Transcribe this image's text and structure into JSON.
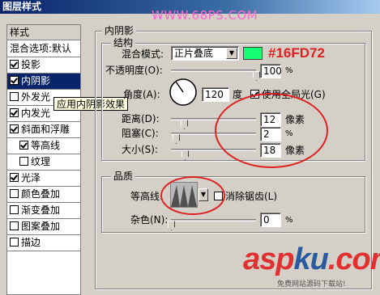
{
  "window": {
    "title": "图层样式"
  },
  "watermark": "WWW.68PS.COM",
  "styles_panel": {
    "header": "样式",
    "blend_options": "混合选项:默认",
    "items": [
      {
        "label": "投影",
        "checked": true
      },
      {
        "label": "内阴影",
        "checked": true,
        "selected": true
      },
      {
        "label": "外发光",
        "checked": false
      },
      {
        "label": "内发光",
        "checked": true
      },
      {
        "label": "斜面和浮雕",
        "checked": true
      },
      {
        "label": "等高线",
        "checked": true,
        "sub": true
      },
      {
        "label": "纹理",
        "checked": false,
        "sub": true
      },
      {
        "label": "光泽",
        "checked": true
      },
      {
        "label": "颜色叠加",
        "checked": false
      },
      {
        "label": "渐变叠加",
        "checked": false
      },
      {
        "label": "图案叠加",
        "checked": false
      },
      {
        "label": "描边",
        "checked": false
      }
    ]
  },
  "tooltip": "应用内阴影效果",
  "inner_shadow": {
    "group_title": "内阴影",
    "structure_title": "结构",
    "blend_mode_label": "混合模式:",
    "blend_mode_value": "正片叠底",
    "color_swatch": "#16FD72",
    "color_annotation": "#16FD72",
    "opacity_label": "不透明度(O):",
    "opacity_value": "100",
    "opacity_unit": "%",
    "angle_label": "角度(A):",
    "angle_value": "120",
    "angle_unit": "度",
    "global_light_label": "使用全局光(G)",
    "global_light_checked": true,
    "distance_label": "距离(D):",
    "distance_value": "12",
    "distance_unit": "像素",
    "choke_label": "阻塞(C):",
    "choke_value": "2",
    "choke_unit": "%",
    "size_label": "大小(S):",
    "size_value": "18",
    "size_unit": "像素"
  },
  "quality": {
    "title": "品质",
    "contour_label": "等高线:",
    "antialias_label": "消除锯齿(L)",
    "antialias_checked": false,
    "noise_label": "杂色(N):",
    "noise_value": "0",
    "noise_unit": "%"
  },
  "logo": {
    "part1": "asp",
    "part2": "ku",
    "part3": ".com",
    "tagline": "免费网站源码下载站!"
  },
  "colors": {
    "annotation_red": "#e02020",
    "swatch_green": "#16FD72",
    "selection_blue": "#0a246a"
  }
}
